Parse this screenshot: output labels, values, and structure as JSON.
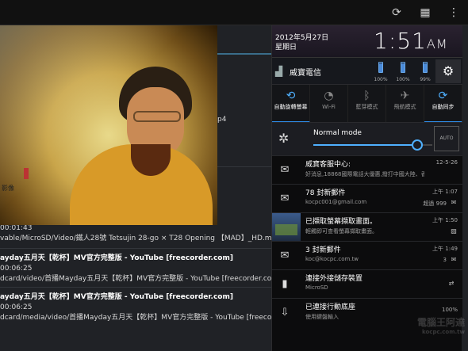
{
  "top_bar": {
    "icons": [
      "refresh-icon",
      "grid-icon",
      "overflow-menu-icon"
    ]
  },
  "files": [
    {
      "title": "",
      "detail": "p4"
    },
    {
      "title": "",
      "detail": "影像"
    },
    {
      "meta": "00:01:43",
      "path": "vable/MicroSD/Video/鐵人28號 Tetsujin 28-go × T28 Opening 【MAD】_HD.mp4"
    },
    {
      "title": "ayday五月天【乾杯】MV官方完整版 - YouTube [freecorder.com]",
      "meta": "00:06:25",
      "path": "dcard/video/首播Mayday五月天【乾杯】MV官方完整版 - YouTube [freecorder.com].mp4"
    },
    {
      "title": "ayday五月天【乾杯】MV官方完整版 - YouTube [freecorder.com]",
      "meta": "00:06:25",
      "path": "dcard/media/video/首播Mayday五月天【乾杯】MV官方完整版 - YouTube [freecorder.com"
    }
  ],
  "notification_panel": {
    "date": "2012年5月27日",
    "weekday": "星期日",
    "clock": "1:51",
    "ampm": "AM",
    "carrier": "威寶電信",
    "batteries": [
      {
        "value": "100%",
        "level": 1.0
      },
      {
        "value": "100%",
        "level": 1.0
      },
      {
        "value": "99%",
        "level": 0.99
      }
    ],
    "toggles": [
      {
        "label": "自動旋轉螢幕",
        "icon": "rotate-icon",
        "on": true
      },
      {
        "label": "Wi-Fi",
        "icon": "wifi-icon",
        "on": false
      },
      {
        "label": "藍芽模式",
        "icon": "bluetooth-icon",
        "on": false
      },
      {
        "label": "飛航模式",
        "icon": "airplane-icon",
        "on": false
      },
      {
        "label": "自動同步",
        "icon": "sync-icon",
        "on": true
      }
    ],
    "brightness": {
      "label": "Normal mode",
      "level": 0.87,
      "auto_label": "AUTO"
    },
    "notifications": [
      {
        "title": "威寶客服中心:",
        "sub": "好消息,18868國際電話大優惠,撥打中國大陸、香港",
        "time": "12-5-26",
        "count": "",
        "icon": "message-icon"
      },
      {
        "title": "78 封新郵件",
        "sub": "kocpc001@gmail.com",
        "time": "上午 1:07",
        "count": "超過 999",
        "icon": "gmail-icon"
      },
      {
        "title": "已擷取螢幕擷取畫面。",
        "sub": "輕觸即可查看螢幕擷取畫面。",
        "time": "上午 1:50",
        "count": "",
        "icon": "screenshot-thumbnail"
      },
      {
        "title": "3 封新郵件",
        "sub": "koc@kocpc.com.tw",
        "time": "上午 1:49",
        "count": "3",
        "icon": "email-icon"
      },
      {
        "title": "連接外接儲存裝置",
        "sub": "MicroSD",
        "time": "",
        "count": "",
        "icon": "sdcard-icon"
      },
      {
        "title": "已連接行動底座",
        "sub": "使用鍵盤輸入",
        "time": "",
        "count": "100%",
        "icon": "dock-icon"
      }
    ]
  },
  "watermark": {
    "text": "電腦王阿達",
    "sub": "kocpc.com.tw"
  }
}
